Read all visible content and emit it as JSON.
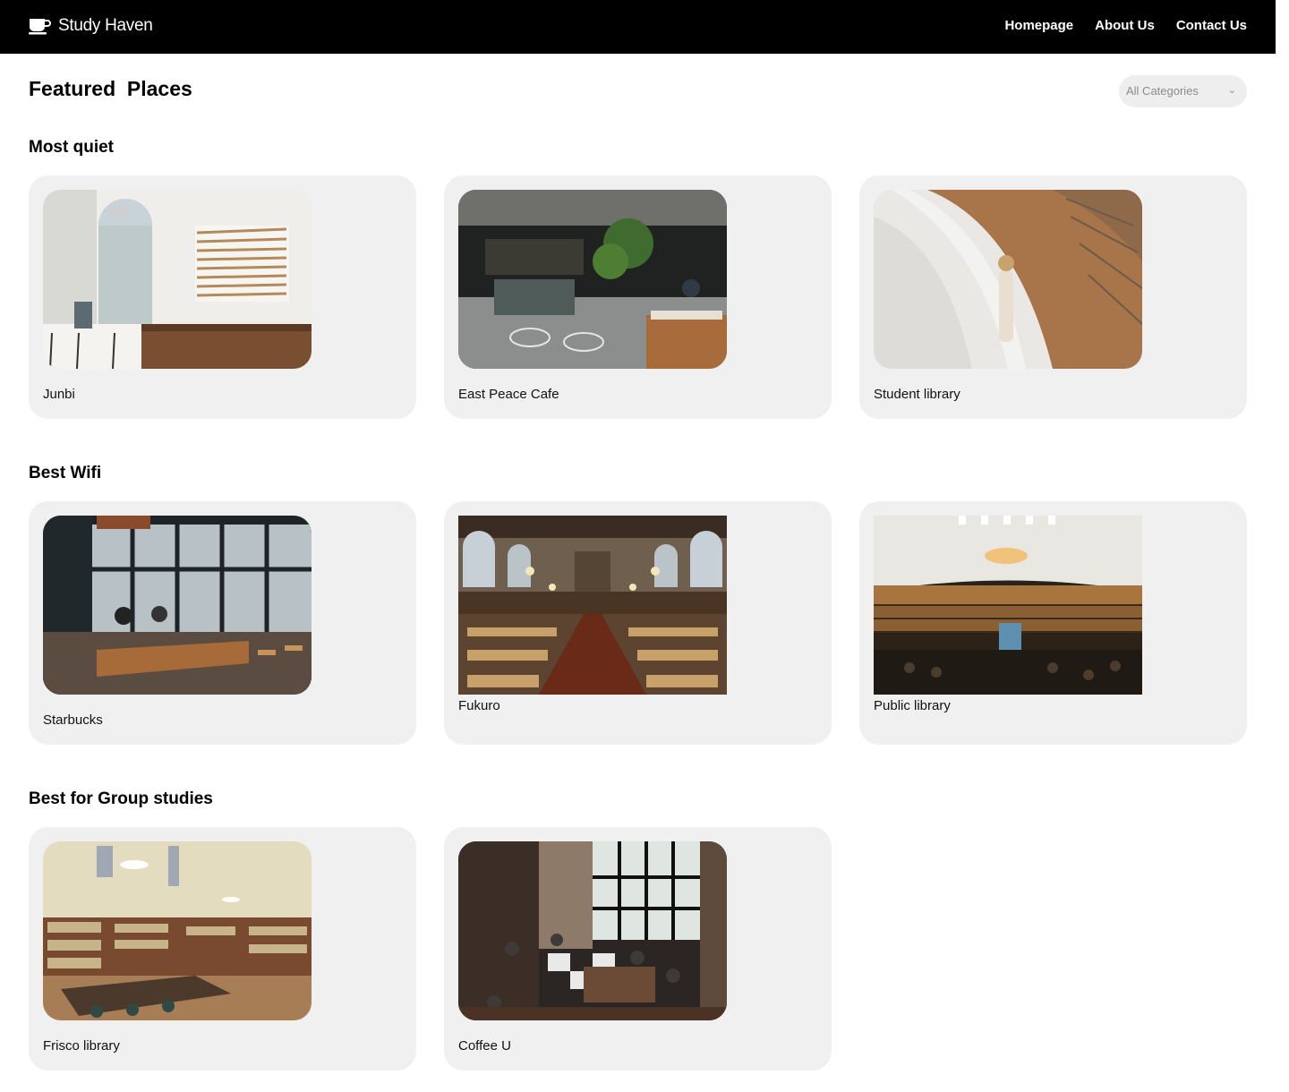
{
  "header": {
    "brand": "Study Haven",
    "brand_icon": "coffee-cup-icon",
    "nav": [
      "Homepage",
      "About Us",
      "Contact Us"
    ]
  },
  "page": {
    "title": "Featured  Places",
    "category_filter": {
      "selected": "All Categories",
      "icon": "chevron-down-icon"
    }
  },
  "sections": [
    {
      "title": "Most quiet",
      "places": [
        {
          "name": "Junbi"
        },
        {
          "name": "East Peace Cafe"
        },
        {
          "name": "Student library"
        }
      ]
    },
    {
      "title": "Best Wifi",
      "places": [
        {
          "name": "Starbucks"
        },
        {
          "name": "Fukuro"
        },
        {
          "name": "Public library"
        }
      ]
    },
    {
      "title": "Best for Group studies",
      "places": [
        {
          "name": "Frisco library"
        },
        {
          "name": "Coffee U"
        }
      ]
    }
  ],
  "colors": {
    "header_bg": "#000000",
    "card_bg": "#f0f0f0",
    "select_bg": "#eeeeee"
  }
}
